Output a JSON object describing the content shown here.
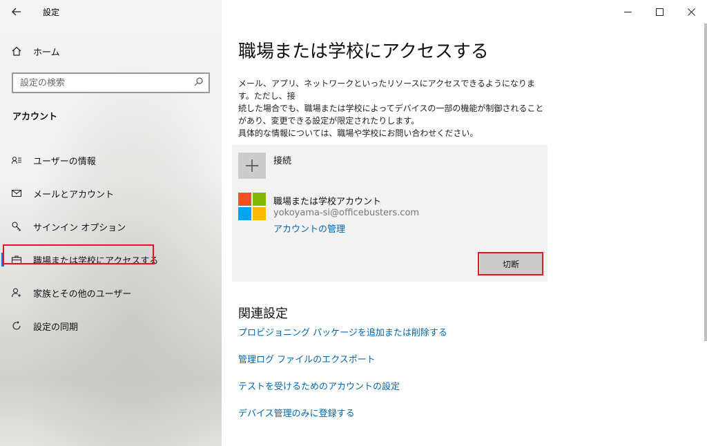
{
  "window": {
    "title": "設定",
    "back_icon": "arrow-left-icon",
    "controls": {
      "minimize": "─",
      "maximize": "☐",
      "close": "✕"
    }
  },
  "sidebar": {
    "home_label": "ホーム",
    "search_placeholder": "設定の検索",
    "section_title": "アカウント",
    "items": [
      {
        "label": "ユーザーの情報",
        "icon": "user-info-icon",
        "glyph": "⚲"
      },
      {
        "label": "メールとアカウント",
        "icon": "mail-icon",
        "glyph": "✉"
      },
      {
        "label": "サインイン オプション",
        "icon": "key-icon",
        "glyph": "⚷"
      },
      {
        "label": "職場または学校にアクセスする",
        "icon": "briefcase-icon",
        "glyph": "▭",
        "selected": true
      },
      {
        "label": "家族とその他のユーザー",
        "icon": "add-user-icon",
        "glyph": "⚇"
      },
      {
        "label": "設定の同期",
        "icon": "sync-icon",
        "glyph": "⟳"
      }
    ]
  },
  "main": {
    "title": "職場または学校にアクセスする",
    "description": [
      "メール、アプリ、ネットワークといったリソースにアクセスできるようになります。ただし、接",
      "続した場合でも、職場または学校によってデバイスの一部の機能が制御されること",
      "があり、変更できる設定が限定されたりします。",
      "具体的な情報については、職場や学校にお問い合わせください。"
    ],
    "connect_label": "接続",
    "account": {
      "name": "職場または学校アカウント",
      "email": "yokoyama-si@officebusters.com",
      "manage_link": "アカウントの管理",
      "disconnect_button": "切断"
    },
    "related": {
      "title": "関連設定",
      "links": [
        "プロビジョニング パッケージを追加または削除する",
        "管理ログ ファイルのエクスポート",
        "テストを受けるためのアカウントの設定",
        "デバイス管理のみに登録する"
      ]
    }
  },
  "colors": {
    "accent": "#0078d7",
    "link": "#0066b4",
    "highlight_box": "#e81123",
    "ms_red": "#f25022",
    "ms_green": "#7fba00",
    "ms_blue": "#00a4ef",
    "ms_yellow": "#ffb900"
  }
}
